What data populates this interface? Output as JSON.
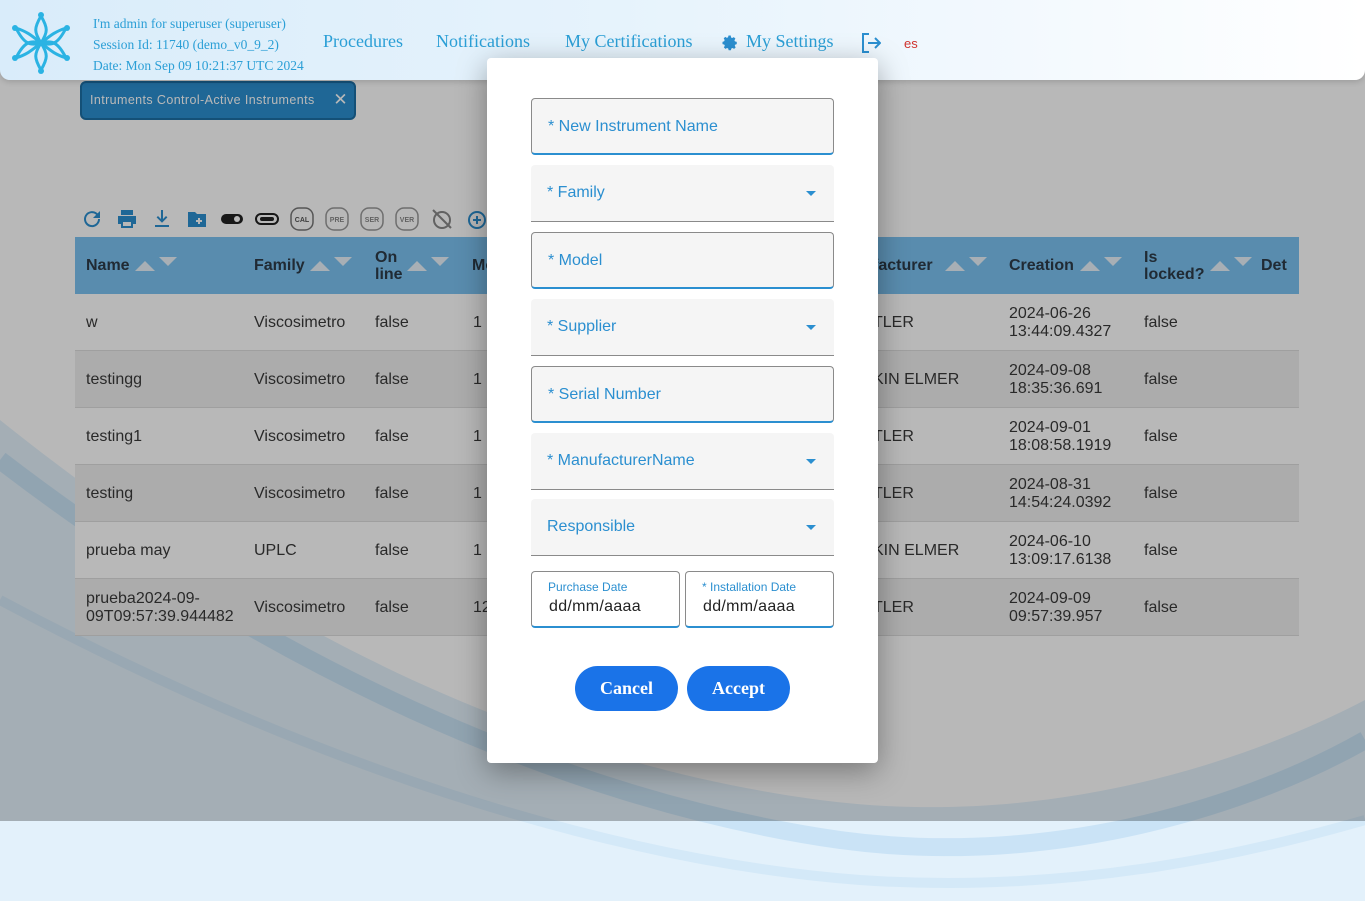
{
  "header": {
    "session_line1": "I'm admin for superuser (superuser)",
    "session_line2": "Session Id: 11740 (demo_v0_9_2)",
    "session_line3": "Date: Mon Sep 09 10:21:37 UTC 2024",
    "nav": {
      "procedures": "Procedures",
      "notifications": "Notifications",
      "certifications": "My Certifications",
      "settings": "My Settings"
    },
    "lang": "es"
  },
  "tab": {
    "label": "Intruments Control-Active Instruments",
    "close": "✕"
  },
  "toolbar": {
    "icons": [
      "refresh-icon",
      "print-icon",
      "download-icon",
      "new-folder-icon",
      "toggle-on-icon",
      "toggle-off-icon",
      "cal-icon",
      "pre-icon",
      "ser-icon",
      "ver-icon",
      "alarm-off-icon",
      "alarm-add-icon"
    ],
    "cal": "CAL",
    "pre": "PRE",
    "ser": "SER",
    "ver": "VER"
  },
  "table": {
    "columns": {
      "name": "Name",
      "family": "Family",
      "online_1": "On",
      "online_2": "line",
      "model": "Mo",
      "manufacturer": "facturer",
      "creation": "Creation",
      "locked_1": "Is",
      "locked_2": "locked?",
      "details": "Det"
    },
    "rows": [
      {
        "name": "w",
        "family": "Viscosimetro",
        "online": "false",
        "model": "1",
        "manufacturer": "TLER",
        "creation_1": "2024-06-26",
        "creation_2": "13:44:09.4327",
        "locked": "false"
      },
      {
        "name": "testingg",
        "family": "Viscosimetro",
        "online": "false",
        "model": "1",
        "manufacturer": "KIN ELMER",
        "creation_1": "2024-09-08",
        "creation_2": "18:35:36.691",
        "locked": "false"
      },
      {
        "name": "testing1",
        "family": "Viscosimetro",
        "online": "false",
        "model": "1",
        "manufacturer": "TLER",
        "creation_1": "2024-09-01",
        "creation_2": "18:08:58.1919",
        "locked": "false"
      },
      {
        "name": "testing",
        "family": "Viscosimetro",
        "online": "false",
        "model": "1",
        "manufacturer": "TLER",
        "creation_1": "2024-08-31",
        "creation_2": "14:54:24.0392",
        "locked": "false"
      },
      {
        "name": "prueba may",
        "family": "UPLC",
        "online": "false",
        "model": "1",
        "manufacturer": "KIN ELMER",
        "creation_1": "2024-06-10",
        "creation_2": "13:09:17.6138",
        "locked": "false"
      },
      {
        "name_1": "prueba2024-09-",
        "name_2": "09T09:57:39.944482",
        "family": "Viscosimetro",
        "online": "false",
        "model": "12",
        "manufacturer": "TLER",
        "creation_1": "2024-09-09",
        "creation_2": "09:57:39.957",
        "locked": "false"
      }
    ]
  },
  "dialog": {
    "fields": {
      "new_instrument_name": "* New Instrument Name",
      "family": "* Family",
      "model": "* Model",
      "supplier": "* Supplier",
      "serial_number": "* Serial Number",
      "manufacturer_name": "* ManufacturerName",
      "responsible": "Responsible"
    },
    "purchase_date": {
      "label": "Purchase Date",
      "value": "dd/mm/aaaa"
    },
    "installation_date": {
      "label": "* Installation Date",
      "value": "dd/mm/aaaa"
    },
    "cancel": "Cancel",
    "accept": "Accept"
  },
  "colors": {
    "accent": "#2b8fd0",
    "button": "#1a73e8",
    "header_text": "#2b9fd6",
    "lang": "#d0332e"
  }
}
